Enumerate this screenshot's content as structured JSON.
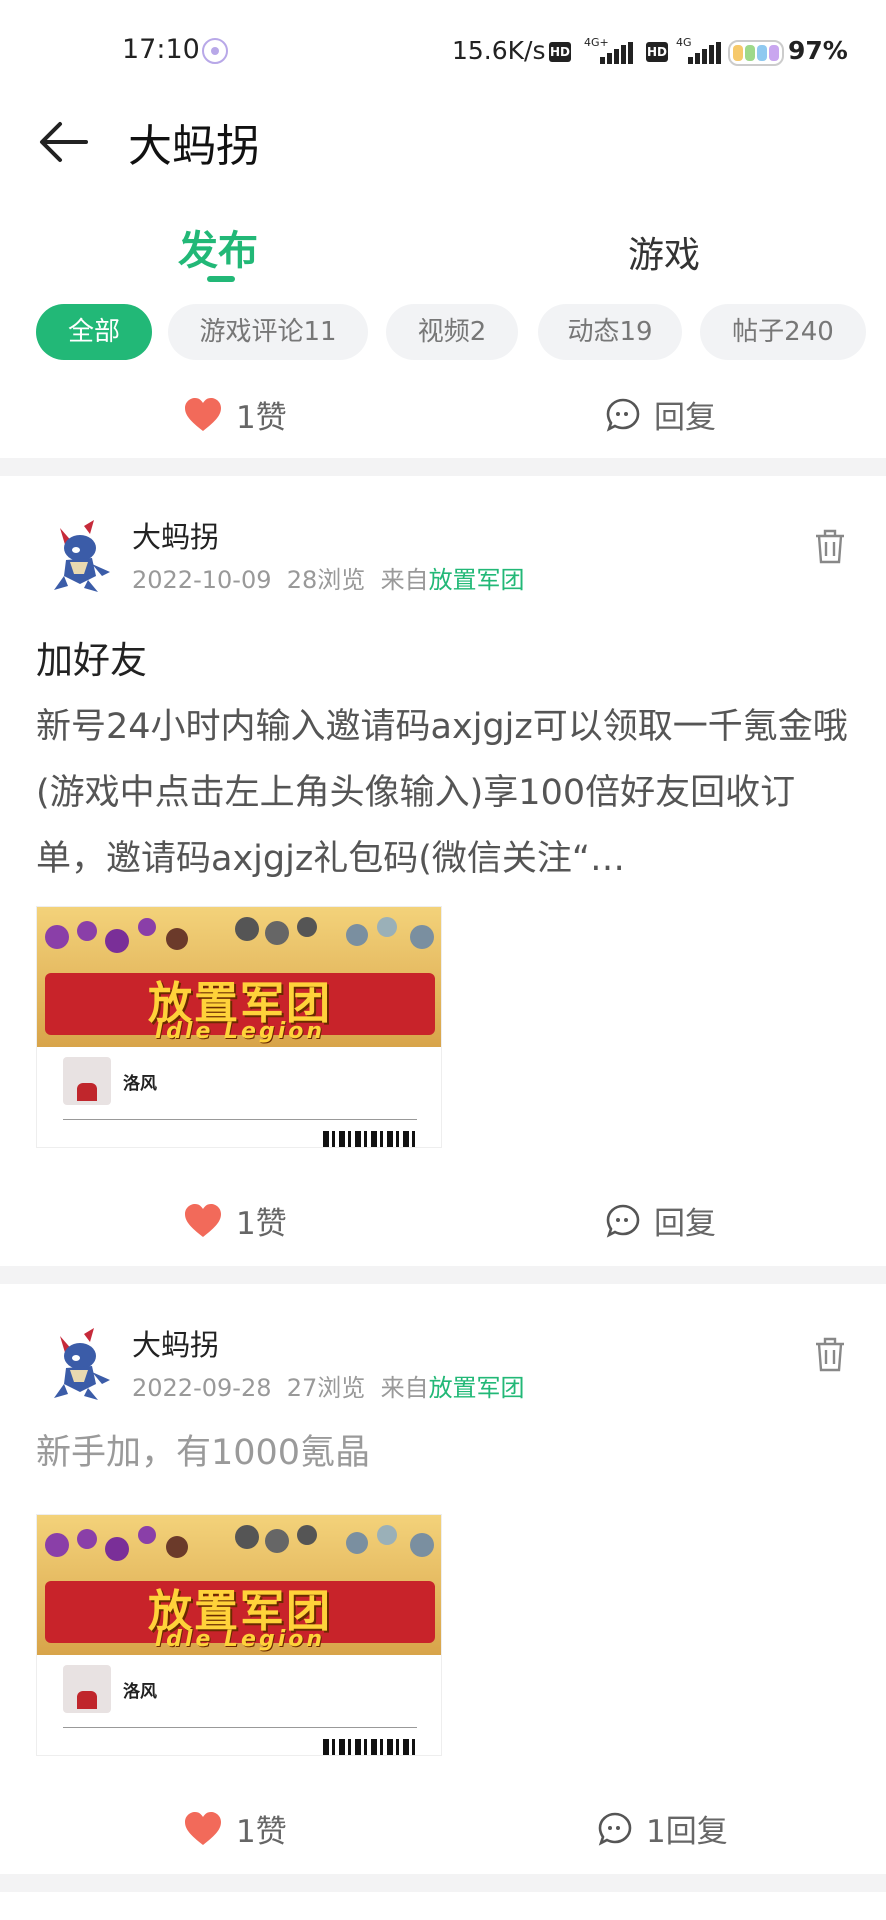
{
  "status_bar": {
    "time": "17:10",
    "speed": "15.6K/s",
    "hd_label": "HD",
    "net1": "4G+",
    "net2": "4G",
    "battery": "97%"
  },
  "header": {
    "title": "大蚂拐"
  },
  "tabs": [
    {
      "label": "发布",
      "active": true
    },
    {
      "label": "游戏",
      "active": false
    }
  ],
  "filters": [
    {
      "label": "全部",
      "active": true
    },
    {
      "label": "游戏评论11",
      "active": false
    },
    {
      "label": "视频2",
      "active": false
    },
    {
      "label": "动态19",
      "active": false
    },
    {
      "label": "帖子240",
      "active": false
    }
  ],
  "posts": [
    {
      "like_label": "1赞",
      "reply_label": "回复"
    },
    {
      "author": "大蚂拐",
      "date": "2022-10-09",
      "views": "28浏览",
      "from_prefix": "来自",
      "source": "放置军团",
      "title": "加好友",
      "body": "新号24小时内输入邀请码axjgjz可以领取一千氪金哦(游戏中点击左上角头像输入)享100倍好友回收订单，邀请码axjgjz礼包码(微信关注“…",
      "thumb_logo": "放置军团",
      "thumb_logo_en": "Idle Legion",
      "thumb_user": "洛风",
      "like_label": "1赞",
      "reply_label": "回复"
    },
    {
      "author": "大蚂拐",
      "date": "2022-09-28",
      "views": "27浏览",
      "from_prefix": "来自",
      "source": "放置军团",
      "body": "新手加，有1000氪晶",
      "thumb_logo": "放置军团",
      "thumb_logo_en": "Idle Legion",
      "thumb_user": "洛风",
      "like_label": "1赞",
      "reply_label": "1回复"
    }
  ],
  "colors": {
    "accent": "#22b877",
    "like": "#f26a5a",
    "divider": "#f3f3f4"
  }
}
